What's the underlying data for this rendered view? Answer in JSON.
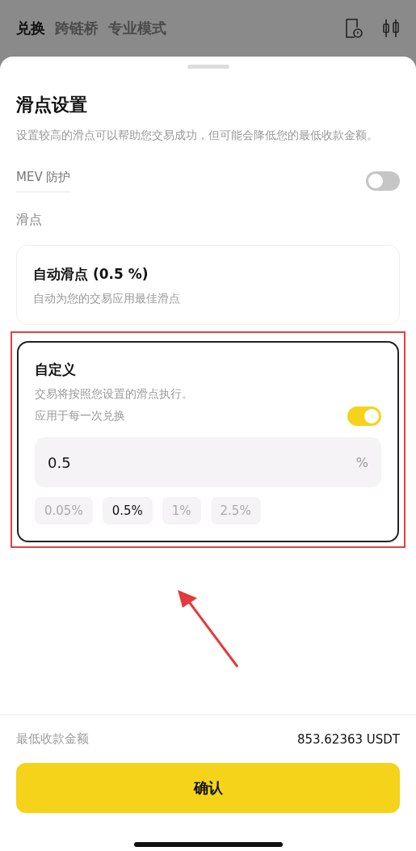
{
  "top_tabs": [
    {
      "label": "兑换",
      "selected": true
    },
    {
      "label": "跨链桥",
      "selected": false
    },
    {
      "label": "专业模式",
      "selected": false
    }
  ],
  "sheet": {
    "title": "滑点设置",
    "description": "设置较高的滑点可以帮助您交易成功，但可能会降低您的最低收款金额。",
    "mev_protection": {
      "label": "MEV 防护",
      "on": false
    },
    "slippage_label": "滑点",
    "options": [
      {
        "kind": "auto",
        "title": "自动滑点 (0.5 %)",
        "subtitle": "自动为您的交易应用最佳滑点",
        "selected": false
      },
      {
        "kind": "custom",
        "title": "自定义",
        "subtitle": "交易将按照您设置的滑点执行。",
        "selected": true,
        "apply_every": {
          "label": "应用于每一次兑换",
          "on": true
        },
        "input": {
          "value": "0.5",
          "unit": "%"
        },
        "presets": [
          {
            "label": "0.05%",
            "selected": false
          },
          {
            "label": "0.5%",
            "selected": true
          },
          {
            "label": "1%",
            "selected": false
          },
          {
            "label": "2.5%",
            "selected": false
          }
        ]
      }
    ]
  },
  "min_received": {
    "label": "最低收款金额",
    "value": "853.62363 USDT"
  },
  "confirm_button": "确认"
}
